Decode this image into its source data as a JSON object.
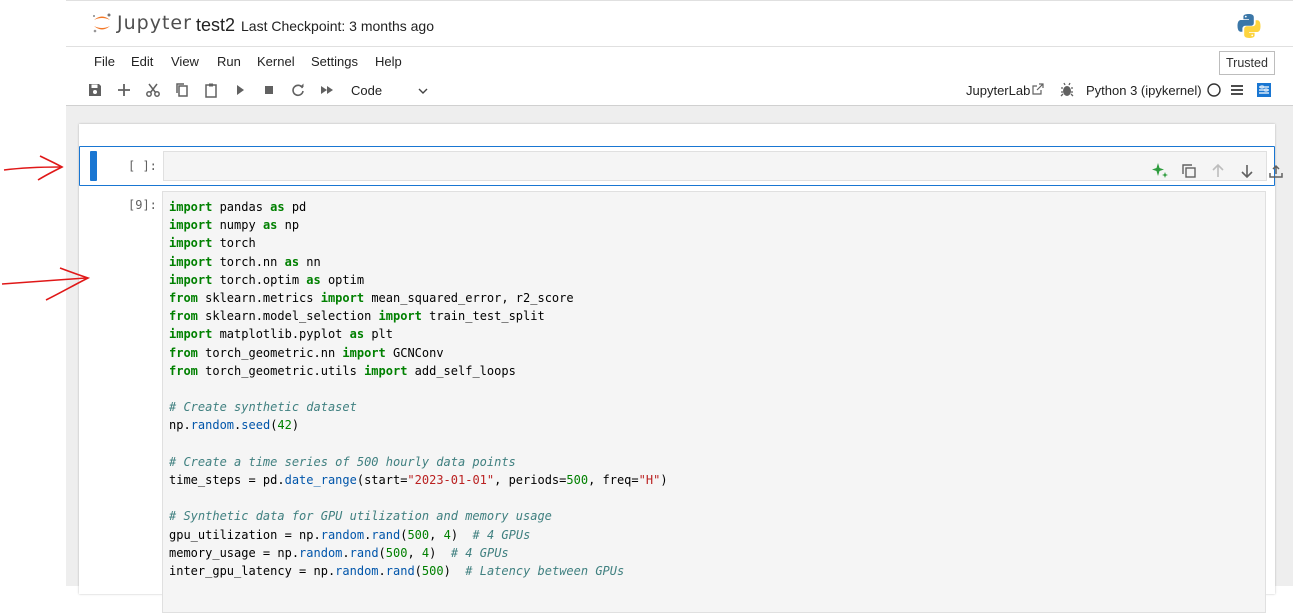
{
  "header": {
    "logo_text": "Jupyter",
    "notebook_name": "test2",
    "checkpoint": "Last Checkpoint: 3 months ago"
  },
  "menu": {
    "items": [
      "File",
      "Edit",
      "View",
      "Run",
      "Kernel",
      "Settings",
      "Help"
    ],
    "trusted": "Trusted"
  },
  "toolbar": {
    "cell_type": "Code",
    "jupyterlab_link": "JupyterLab",
    "kernel_name": "Python 3 (ipykernel)"
  },
  "cells": [
    {
      "prompt": "[ ]:",
      "source": ""
    },
    {
      "prompt": "[9]:"
    }
  ],
  "colors": {
    "accent": "#1976d2",
    "annotation_red": "#e01818"
  }
}
